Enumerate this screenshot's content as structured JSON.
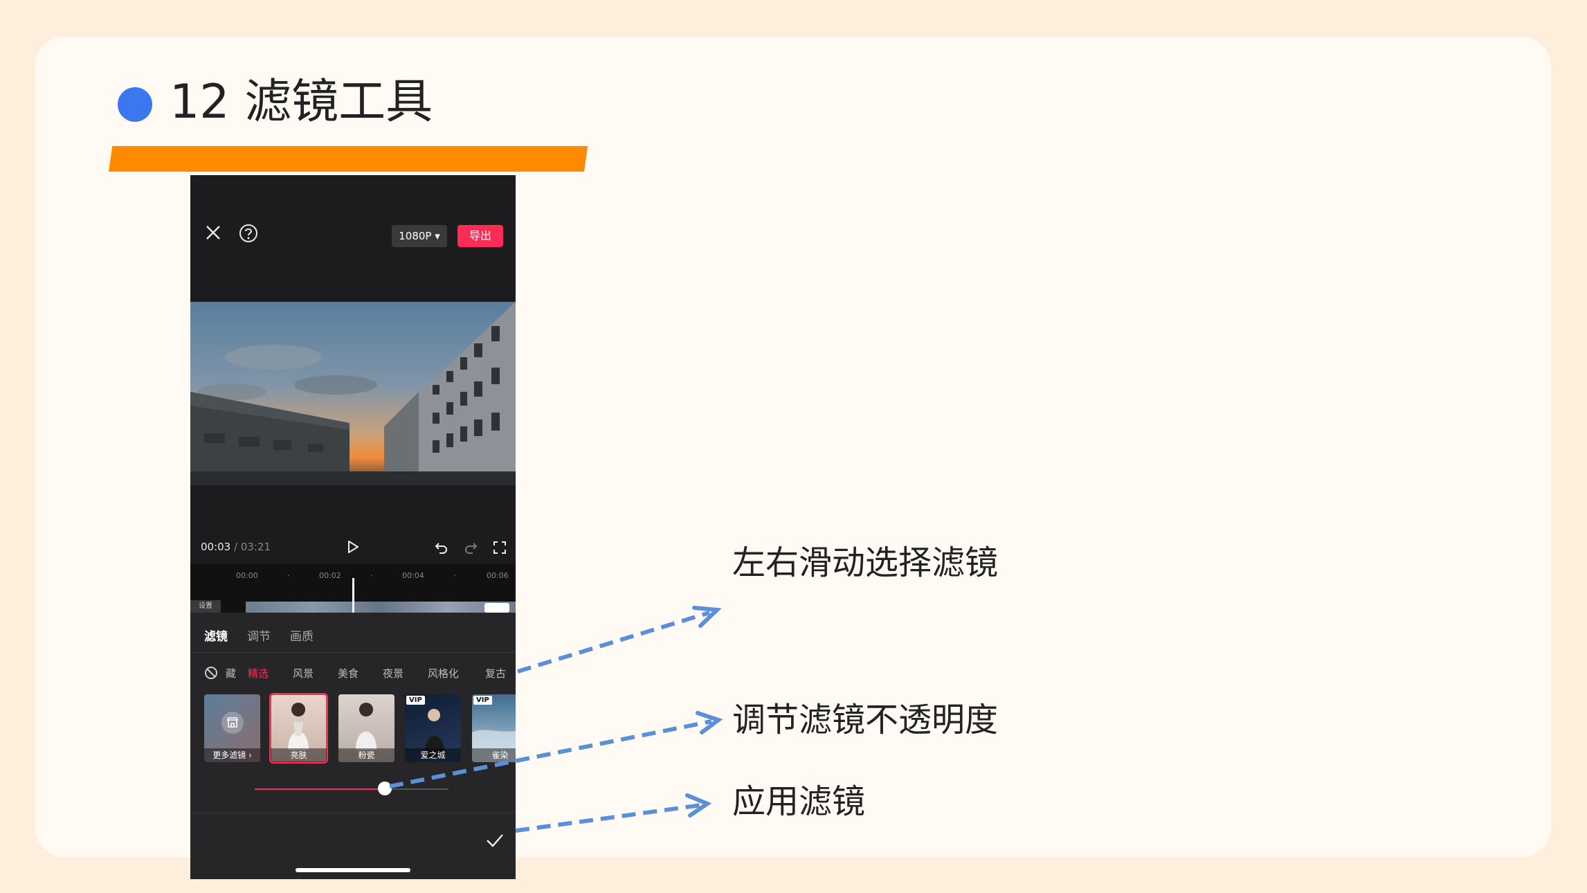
{
  "slide": {
    "title": "12 滤镜工具",
    "accent_color": "#ff8a00",
    "dot_color": "#3b78f0"
  },
  "app": {
    "header": {
      "close_icon": "close-icon",
      "help_icon": "help-icon",
      "resolution_label": "1080P ▾",
      "export_label": "导出"
    },
    "playback": {
      "current_time": "00:03",
      "separator": " / ",
      "total_time": "03:21"
    },
    "timeline": {
      "ticks": [
        "00:00",
        "·",
        "00:02",
        "·",
        "00:04",
        "·",
        "00:06"
      ],
      "cover_label": "设置"
    },
    "panel": {
      "tabs": [
        {
          "label": "滤镜",
          "active": true
        },
        {
          "label": "调节",
          "active": false
        },
        {
          "label": "画质",
          "active": false
        }
      ],
      "categories": [
        {
          "label": "收藏",
          "active": false
        },
        {
          "label": "精选",
          "active": true
        },
        {
          "label": "风景",
          "active": false
        },
        {
          "label": "美食",
          "active": false
        },
        {
          "label": "夜景",
          "active": false
        },
        {
          "label": "风格化",
          "active": false
        },
        {
          "label": "复古",
          "active": false
        }
      ],
      "filters": [
        {
          "label": "更多滤镜 ›",
          "vip": false,
          "selected": false
        },
        {
          "label": "亮肤",
          "vip": false,
          "selected": true
        },
        {
          "label": "粉瓷",
          "vip": false,
          "selected": false
        },
        {
          "label": "爱之城",
          "vip": true,
          "selected": false
        },
        {
          "label": "雀染",
          "vip": true,
          "selected": false
        }
      ],
      "vip_badge": "VIP",
      "intensity": 0.67,
      "brand_color": "#fe2c55"
    }
  },
  "callouts": {
    "swipe": "左右滑动选择滤镜",
    "opacity": "调节滤镜不透明度",
    "apply": "应用滤镜",
    "arrow_color": "#5b8fd8"
  }
}
